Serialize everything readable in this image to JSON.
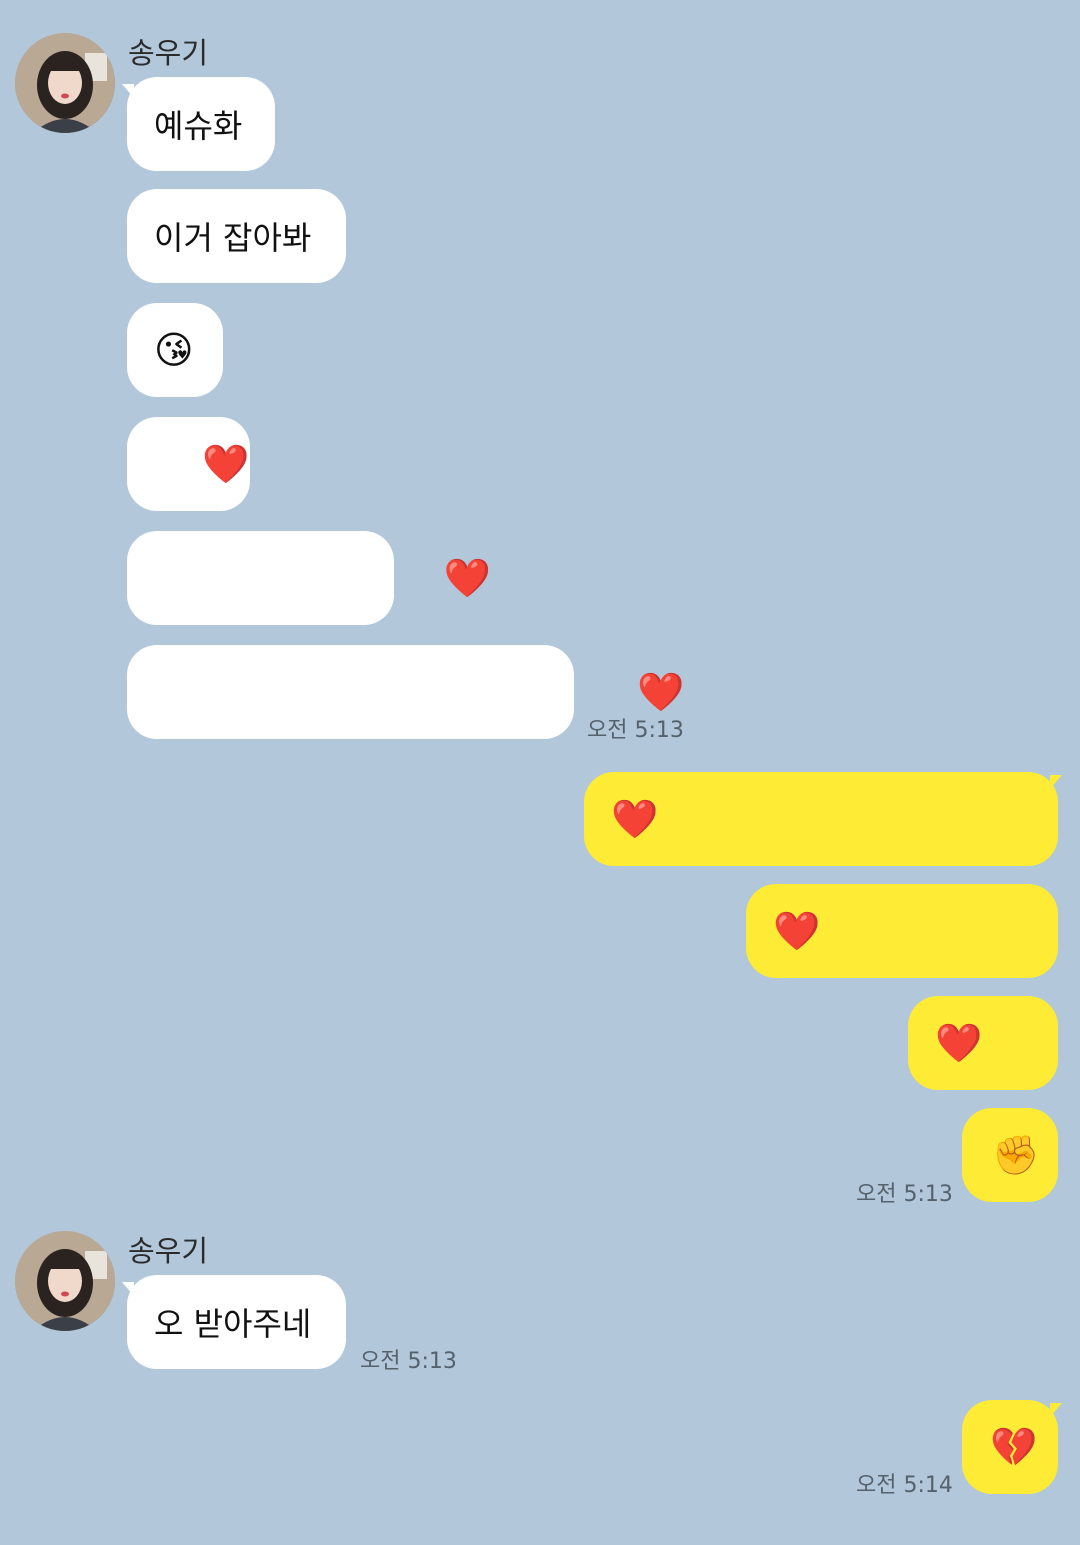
{
  "chat": {
    "group1": {
      "sender": "송우기",
      "messages": [
        "예슈화",
        "이거 잡아봐",
        "😘",
        "    ❤️",
        "                        ❤️",
        "                                        ❤️"
      ],
      "time": "오전 5:13"
    },
    "mine1": {
      "messages": [
        "❤️",
        "❤️",
        "❤️",
        "✊"
      ],
      "time": "오전 5:13"
    },
    "group2": {
      "sender": "송우기",
      "messages": [
        "오 받아주네"
      ],
      "time": "오전 5:13"
    },
    "mine2": {
      "messages": [
        "💔"
      ],
      "time": "오전 5:14"
    }
  },
  "colors": {
    "background": "#b2c7da",
    "incoming_bubble": "#ffffff",
    "outgoing_bubble": "#feeb35",
    "timestamp": "#55616b"
  }
}
